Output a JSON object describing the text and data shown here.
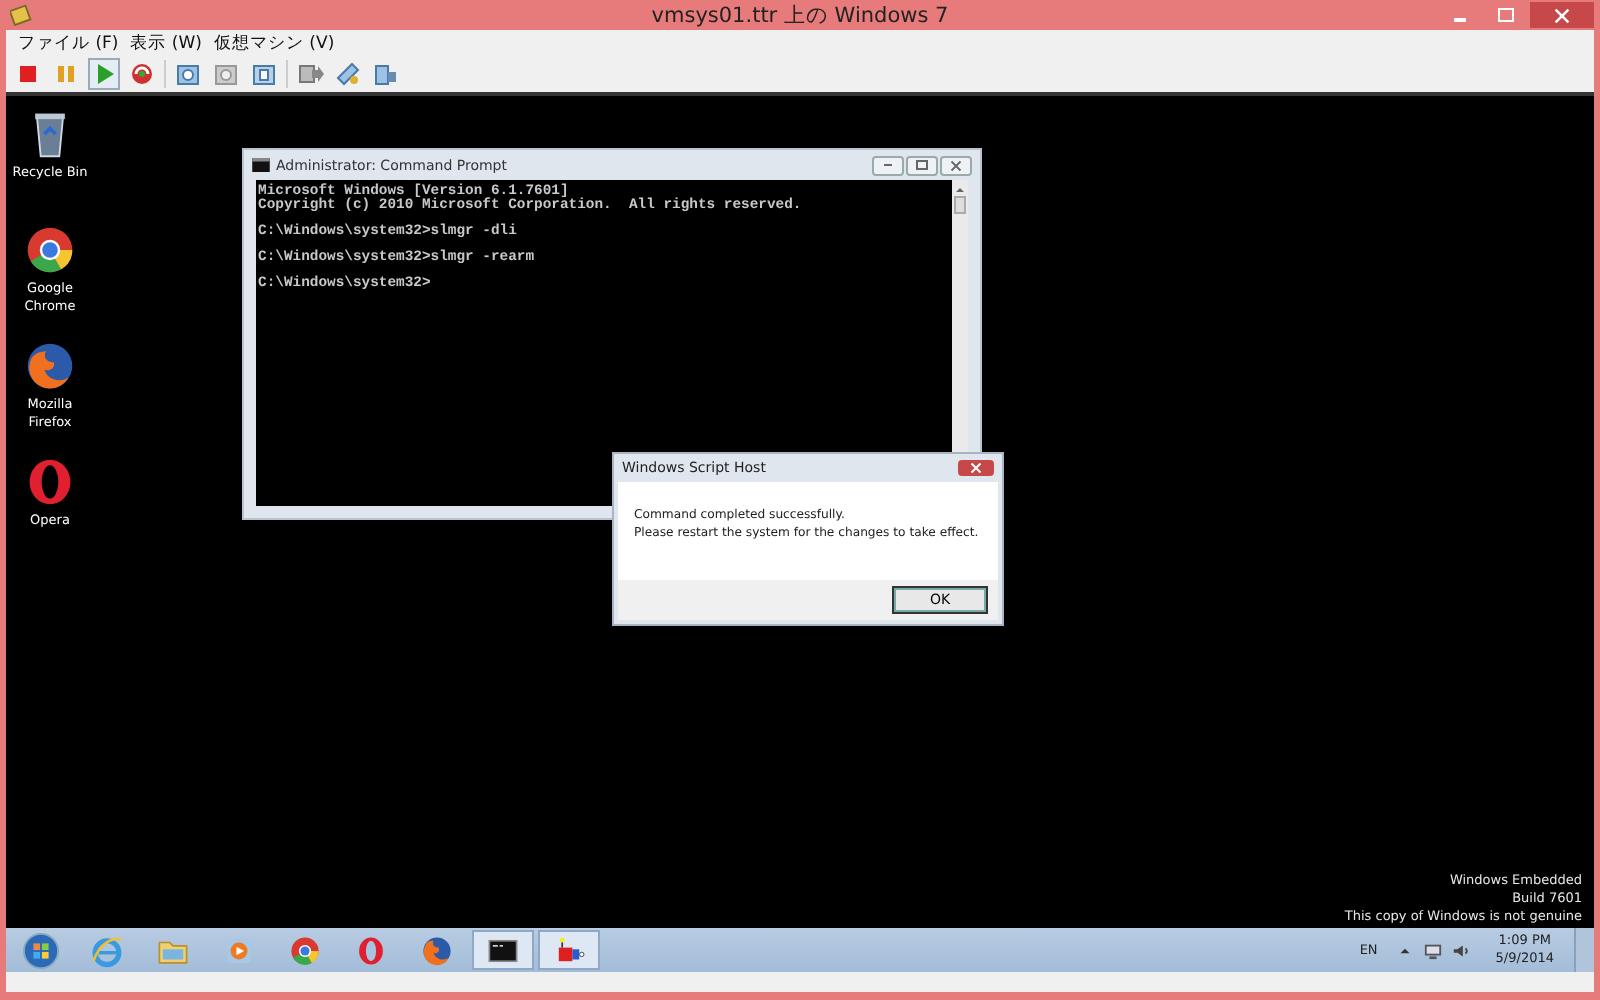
{
  "window": {
    "title": "vmsys01.ttr 上の Windows 7"
  },
  "menu": [
    "ファイル (F)",
    "表示 (W)",
    "仮想マシン (V)"
  ],
  "desktop_icons": [
    {
      "kind": "bin",
      "label": "Recycle Bin"
    },
    {
      "kind": "chrome",
      "label": "Google Chrome"
    },
    {
      "kind": "firefox",
      "label": "Mozilla Firefox"
    },
    {
      "kind": "opera",
      "label": "Opera"
    }
  ],
  "cmd": {
    "title": "Administrator: Command Prompt",
    "lines": [
      "Microsoft Windows [Version 6.1.7601]",
      "Copyright (c) 2010 Microsoft Corporation.  All rights reserved.",
      "C:\\Windows\\system32>slmgr -dli",
      "C:\\Windows\\system32>slmgr -rearm",
      "C:\\Windows\\system32>"
    ]
  },
  "dialog": {
    "title": "Windows Script Host",
    "message": [
      "Command completed successfully.",
      "Please restart the system for the changes to take effect."
    ],
    "button": "OK"
  },
  "watermark": [
    "Windows Embedded",
    "Build 7601",
    "This copy of Windows is not genuine"
  ],
  "taskbar": [
    {
      "kind": "ie",
      "selected": false
    },
    {
      "kind": "folder",
      "selected": false
    },
    {
      "kind": "media",
      "selected": false
    },
    {
      "kind": "chrome",
      "selected": false
    },
    {
      "kind": "opera",
      "selected": false
    },
    {
      "kind": "firefox",
      "selected": false
    },
    {
      "kind": "cmd",
      "selected": true
    },
    {
      "kind": "app",
      "selected": true
    }
  ],
  "tray": {
    "language": "EN",
    "time": "1:09 PM",
    "date": "5/9/2014"
  }
}
